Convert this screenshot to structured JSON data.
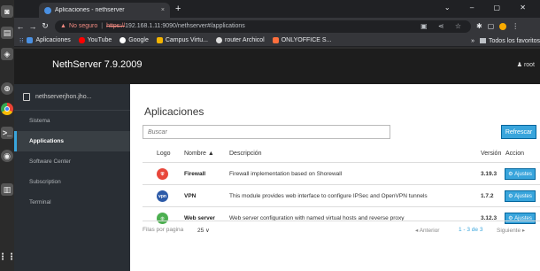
{
  "dock": {
    "icons": [
      "camera-icon",
      "files-icon",
      "nethserver-icon",
      "help-icon",
      "chrome-icon",
      "terminal-icon",
      "disk-icon",
      "trash-icon",
      "apps-grid-icon"
    ]
  },
  "browser": {
    "tab_title": "Aplicaciones - nethserver",
    "tab_close": "×",
    "new_tab": "+",
    "insecure_label": "No seguro",
    "url_scheme": "https://",
    "url_rest": "192.168.1.11:9090/nethserver#/applications",
    "bookmarks": [
      {
        "label": "Aplicaciones",
        "color": "#4a90e2"
      },
      {
        "label": "YouTube",
        "color": "#ff0000"
      },
      {
        "label": "Google",
        "color": "#ffffff"
      },
      {
        "label": "Campus Virtu...",
        "color": "#f4b400"
      },
      {
        "label": "router Archicol",
        "color": "#dddddd"
      },
      {
        "label": "ONLYOFFICE S...",
        "color": "#ff6f3d"
      }
    ],
    "bookmarks_more": "»",
    "all_bookmarks": "Todos los favoritos"
  },
  "header": {
    "brand": "NethServer 7.9.2009",
    "user": "root"
  },
  "sidebar": {
    "host": "nethserverjhon.jho...",
    "items": [
      {
        "label": "Sistema",
        "active": false
      },
      {
        "label": "Applications",
        "active": true
      },
      {
        "label": "Software Center",
        "active": false
      },
      {
        "label": "Subscription",
        "active": false
      },
      {
        "label": "Terminal",
        "active": false
      }
    ]
  },
  "main": {
    "title": "Aplicaciones",
    "search_placeholder": "Buscar",
    "refresh_label": "Refrescar",
    "columns": {
      "logo": "Logo",
      "name": "Nombre ▲",
      "description": "Descripción",
      "version": "Versión",
      "action": "Accion"
    },
    "rows": [
      {
        "name": "Firewall",
        "description": "Firewall implementation based on Shorewall",
        "version": "3.19.3",
        "action": "Ajustes",
        "logo_color": "#e8473b"
      },
      {
        "name": "VPN",
        "description": "This module provides web interface to configure IPSec and OpenVPN tunnels",
        "version": "1.7.2",
        "action": "Ajustes",
        "logo_color": "#2c5aa8"
      },
      {
        "name": "Web server",
        "description": "Web server configuration with named virtual hosts and reverse proxy",
        "version": "3.12.3",
        "action": "Ajustes",
        "logo_color": "#4caf50"
      }
    ],
    "pager": {
      "per_page_label": "Filas por pagina",
      "per_page_value": "25 ∨",
      "prev": "◂ Anterior",
      "range": "1 - 3 de 3",
      "next": "Siguiente ▸"
    }
  }
}
